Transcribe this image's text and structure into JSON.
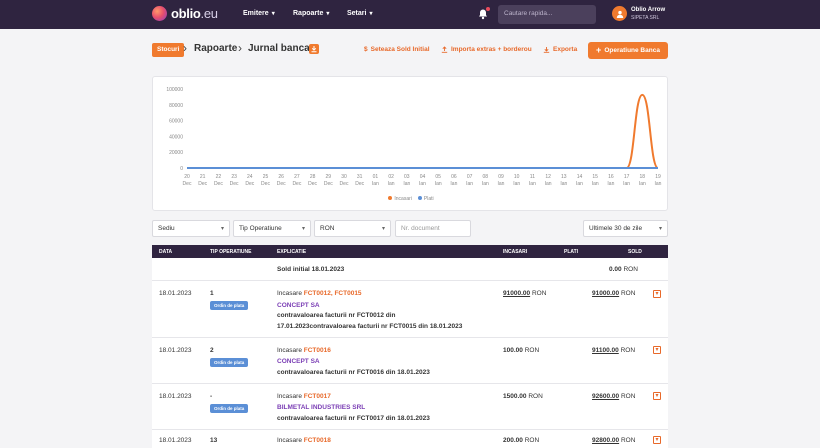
{
  "brand": {
    "name": "oblio",
    "tld": ".eu"
  },
  "nav": [
    {
      "label": "Emitere"
    },
    {
      "label": "Rapoarte"
    },
    {
      "label": "Setari"
    }
  ],
  "search": {
    "placeholder": "Cautare rapida..."
  },
  "user": {
    "name": "Oblio Arrow",
    "company": "SIPETA SRL"
  },
  "breadcrumb": {
    "badge": "Stocuri",
    "section": "Rapoarte",
    "page": "Jurnal banca"
  },
  "actions": {
    "set_initial_balance": "Seteaza Sold Initial",
    "import_statement": "Importa extras + borderou",
    "export": "Exporta",
    "bank_operation": "Operatiune Banca"
  },
  "chart_data": {
    "type": "line",
    "categories": [
      "20 Dec",
      "21 Dec",
      "22 Dec",
      "23 Dec",
      "24 Dec",
      "25 Dec",
      "26 Dec",
      "27 Dec",
      "28 Dec",
      "29 Dec",
      "30 Dec",
      "31 Dec",
      "01 Ian",
      "02 Ian",
      "03 Ian",
      "04 Ian",
      "05 Ian",
      "06 Ian",
      "07 Ian",
      "08 Ian",
      "09 Ian",
      "10 Ian",
      "11 Ian",
      "12 Ian",
      "13 Ian",
      "14 Ian",
      "15 Ian",
      "16 Ian",
      "17 Ian",
      "18 Ian",
      "19 Ian"
    ],
    "yticks": [
      "0",
      "20000",
      "40000",
      "60000",
      "80000",
      "100000"
    ],
    "ylim": [
      0,
      100000
    ],
    "series": [
      {
        "name": "Incasari",
        "color": "#f07a2e",
        "values": [
          0,
          0,
          0,
          0,
          0,
          0,
          0,
          0,
          0,
          0,
          0,
          0,
          0,
          0,
          0,
          0,
          0,
          0,
          0,
          0,
          0,
          0,
          0,
          0,
          0,
          0,
          0,
          0,
          0,
          92600,
          0
        ]
      },
      {
        "name": "Plati",
        "color": "#5b8fd6",
        "values": [
          0,
          0,
          0,
          0,
          0,
          0,
          0,
          0,
          0,
          0,
          0,
          0,
          0,
          0,
          0,
          0,
          0,
          0,
          0,
          0,
          0,
          0,
          0,
          0,
          0,
          0,
          0,
          0,
          0,
          0,
          0
        ]
      }
    ],
    "legend_position": "bottom"
  },
  "filters": {
    "sediu": "Sediu",
    "tip_operatiune": "Tip Operatiune",
    "currency": "RON",
    "doc_placeholder": "Nr. document",
    "period": "Ultimele 30 de zile"
  },
  "table": {
    "headers": {
      "data": "DATA",
      "tip": "TIP OPERATIUNE",
      "explicatie": "EXPLICATIE",
      "incasari": "INCASARI",
      "plati": "PLATI",
      "sold": "SOLD"
    },
    "opening": {
      "label": "Sold initial 18.01.2023",
      "amount": "0.00",
      "currency": "RON"
    },
    "rows": [
      {
        "date": "18.01.2023",
        "number": "1",
        "type_badge": "Ordin de plata",
        "prefix": "Incasare",
        "invoices": "FCT0012, FCT0015",
        "partner": "CONCEPT SA",
        "desc_line1": "contravaloarea facturii nr FCT0012 din",
        "desc_line2": "17.01.2023contravaloarea facturii nr FCT0015 din 18.01.2023",
        "incasari": "91000.00",
        "incasari_cur": "RON",
        "sold": "91000.00",
        "sold_cur": "RON"
      },
      {
        "date": "18.01.2023",
        "number": "2",
        "type_badge": "Ordin de plata",
        "prefix": "Incasare",
        "invoices": "FCT0016",
        "partner": "CONCEPT SA",
        "desc_line1": "contravaloarea facturii nr FCT0016 din 18.01.2023",
        "incasari": "100.00",
        "incasari_cur": "RON",
        "sold": "91100.00",
        "sold_cur": "RON"
      },
      {
        "date": "18.01.2023",
        "number": "-",
        "type_badge": "Ordin de plata",
        "prefix": "Incasare",
        "invoices": "FCT0017",
        "partner": "BILMETAL INDUSTRIES SRL",
        "desc_line1": "contravaloarea facturii nr FCT0017 din 18.01.2023",
        "incasari": "1500.00",
        "incasari_cur": "RON",
        "sold": "92600.00",
        "sold_cur": "RON"
      },
      {
        "date": "18.01.2023",
        "number": "13",
        "prefix": "Incasare",
        "invoices": "FCT0018",
        "incasari": "200.00",
        "incasari_cur": "RON",
        "sold": "92800.00",
        "sold_cur": "RON"
      }
    ]
  }
}
